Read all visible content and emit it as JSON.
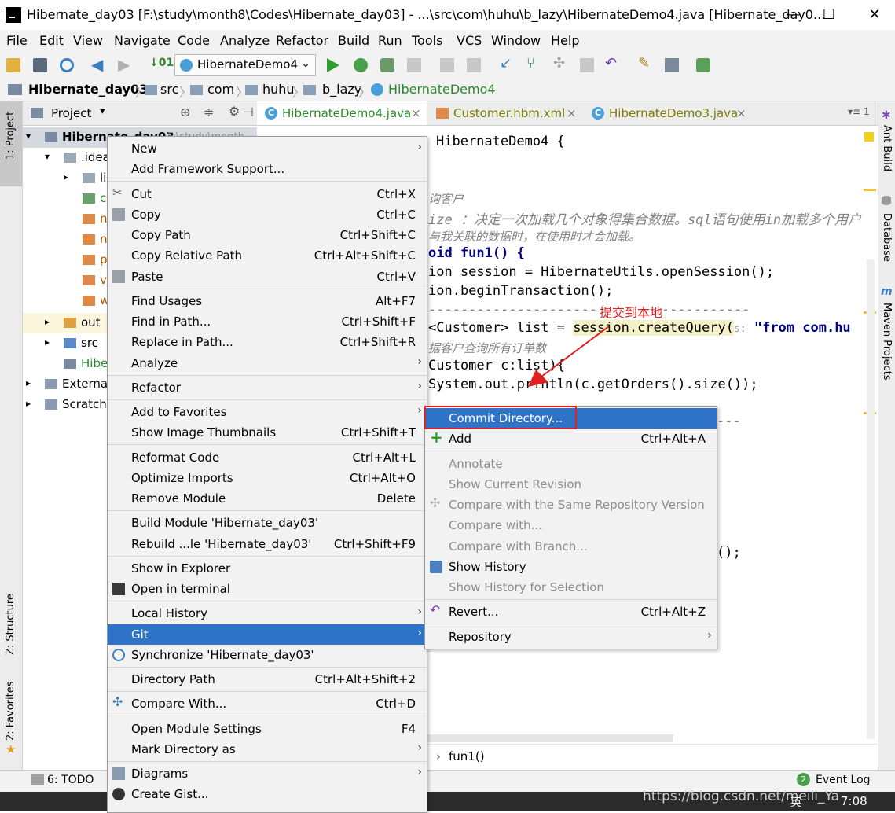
{
  "window": {
    "title": "Hibernate_day03 [F:\\study\\month8\\Codes\\Hibernate_day03] - ...\\src\\com\\huhu\\b_lazy\\HibernateDemo4.java [Hibernate_day0...",
    "minimize": "—",
    "maximize": "☐",
    "close": "✕"
  },
  "menubar": [
    "File",
    "Edit",
    "View",
    "Navigate",
    "Code",
    "Analyze",
    "Refactor",
    "Build",
    "Run",
    "Tools",
    "VCS",
    "Window",
    "Help"
  ],
  "toolbar": {
    "run_config": "HibernateDemo4"
  },
  "breadcrumb": [
    "Hibernate_day03",
    "src",
    "com",
    "huhu",
    "b_lazy",
    "HibernateDemo4"
  ],
  "left_strip": {
    "project": "1: Project",
    "structure": "Z: Structure",
    "favorites": "2: Favorites"
  },
  "right_strip": {
    "ant": "Ant Build",
    "database": "Database",
    "maven": "Maven Projects"
  },
  "project_panel": {
    "header": "Project",
    "rows": [
      {
        "label": "Hibernate_day03",
        "extra": "F:\\study\\month"
      },
      {
        "label": ".idea"
      },
      {
        "label": "lib"
      },
      {
        "label": "c"
      },
      {
        "label": "n"
      },
      {
        "label": "n"
      },
      {
        "label": "p"
      },
      {
        "label": "v"
      },
      {
        "label": "w"
      },
      {
        "label": "out"
      },
      {
        "label": "src"
      },
      {
        "label": "Hibe"
      },
      {
        "label": "External"
      },
      {
        "label": "Scratche"
      }
    ]
  },
  "editor_tabs": [
    {
      "label": "HibernateDemo4.java",
      "close": "×"
    },
    {
      "label": "Customer.hbm.xml",
      "close": "×"
    },
    {
      "label": "HibernateDemo3.java",
      "close": "×"
    }
  ],
  "tab_overflow": "▾≡ 1",
  "code": {
    "line1": "HibernateDemo4 {",
    "comment1": "询客户",
    "comment2": "ize ：决定一次加载几个对象得集合数据。sql语句使用in加载多个用户",
    "comment3": "与我关联的数据时，在使用时才会加载。",
    "line_fun": "oid fun1() {",
    "line_session": "ion session = HibernateUtils.openSession();",
    "line_tx": "ion.beginTransaction();",
    "line_dash": "----------------------------------------",
    "annotation": "提交到本地",
    "line_query_a": "<Customer> list = ",
    "line_query_b": "session.createQuery(",
    "line_query_hint": "s:",
    "line_query_c": "\"from com.hu",
    "comment4": "据客户查询所有订单数",
    "line_for": "Customer c:list){",
    "line_print": "System.out.println(c.getOrders().size());",
    "line_dash2": "---",
    "line_end": "();",
    "breadcrumb_method": "fun1()"
  },
  "context_menu": [
    {
      "label": "New",
      "shortcut": "",
      "submenu": true
    },
    {
      "label": "Add Framework Support...",
      "shortcut": ""
    },
    {
      "label": "Cut",
      "shortcut": "Ctrl+X"
    },
    {
      "label": "Copy",
      "shortcut": "Ctrl+C"
    },
    {
      "label": "Copy Path",
      "shortcut": "Ctrl+Shift+C"
    },
    {
      "label": "Copy Relative Path",
      "shortcut": "Ctrl+Alt+Shift+C"
    },
    {
      "label": "Paste",
      "shortcut": "Ctrl+V"
    },
    {
      "label": "Find Usages",
      "shortcut": "Alt+F7"
    },
    {
      "label": "Find in Path...",
      "shortcut": "Ctrl+Shift+F"
    },
    {
      "label": "Replace in Path...",
      "shortcut": "Ctrl+Shift+R"
    },
    {
      "label": "Analyze",
      "shortcut": "",
      "submenu": true
    },
    {
      "label": "Refactor",
      "shortcut": "",
      "submenu": true
    },
    {
      "label": "Add to Favorites",
      "shortcut": "",
      "submenu": true
    },
    {
      "label": "Show Image Thumbnails",
      "shortcut": "Ctrl+Shift+T"
    },
    {
      "label": "Reformat Code",
      "shortcut": "Ctrl+Alt+L"
    },
    {
      "label": "Optimize Imports",
      "shortcut": "Ctrl+Alt+O"
    },
    {
      "label": "Remove Module",
      "shortcut": "Delete"
    },
    {
      "label": "Build Module 'Hibernate_day03'",
      "shortcut": ""
    },
    {
      "label": "Rebuild ...le 'Hibernate_day03'",
      "shortcut": "Ctrl+Shift+F9"
    },
    {
      "label": "Show in Explorer",
      "shortcut": ""
    },
    {
      "label": "Open in terminal",
      "shortcut": ""
    },
    {
      "label": "Local History",
      "shortcut": "",
      "submenu": true
    },
    {
      "label": "Git",
      "shortcut": "",
      "submenu": true
    },
    {
      "label": "Synchronize 'Hibernate_day03'",
      "shortcut": ""
    },
    {
      "label": "Directory Path",
      "shortcut": "Ctrl+Alt+Shift+2"
    },
    {
      "label": "Compare With...",
      "shortcut": "Ctrl+D"
    },
    {
      "label": "Open Module Settings",
      "shortcut": "F4"
    },
    {
      "label": "Mark Directory as",
      "shortcut": "",
      "submenu": true
    },
    {
      "label": "Diagrams",
      "shortcut": "",
      "submenu": true
    },
    {
      "label": "Create Gist...",
      "shortcut": ""
    }
  ],
  "git_submenu": [
    {
      "label": "Commit Directory...",
      "shortcut": ""
    },
    {
      "label": "Add",
      "shortcut": "Ctrl+Alt+A"
    },
    {
      "label": "Annotate",
      "shortcut": ""
    },
    {
      "label": "Show Current Revision",
      "shortcut": ""
    },
    {
      "label": "Compare with the Same Repository Version",
      "shortcut": ""
    },
    {
      "label": "Compare with...",
      "shortcut": ""
    },
    {
      "label": "Compare with Branch...",
      "shortcut": ""
    },
    {
      "label": "Show History",
      "shortcut": ""
    },
    {
      "label": "Show History for Selection",
      "shortcut": ""
    },
    {
      "label": "Revert...",
      "shortcut": "Ctrl+Alt+Z"
    },
    {
      "label": "Repository",
      "shortcut": "",
      "submenu": true
    }
  ],
  "status": {
    "todo": "6: TODO",
    "event_log": "Event Log",
    "event_count": "2",
    "watermark": "https://blog.csdn.net/meili_Ya",
    "clock": "7:08",
    "ime": "英"
  },
  "colors": {
    "selection": "#2f73c8",
    "annotation_red": "#e02020",
    "tab_green": "#2a8a2a",
    "tab_olive": "#7a7a00"
  }
}
